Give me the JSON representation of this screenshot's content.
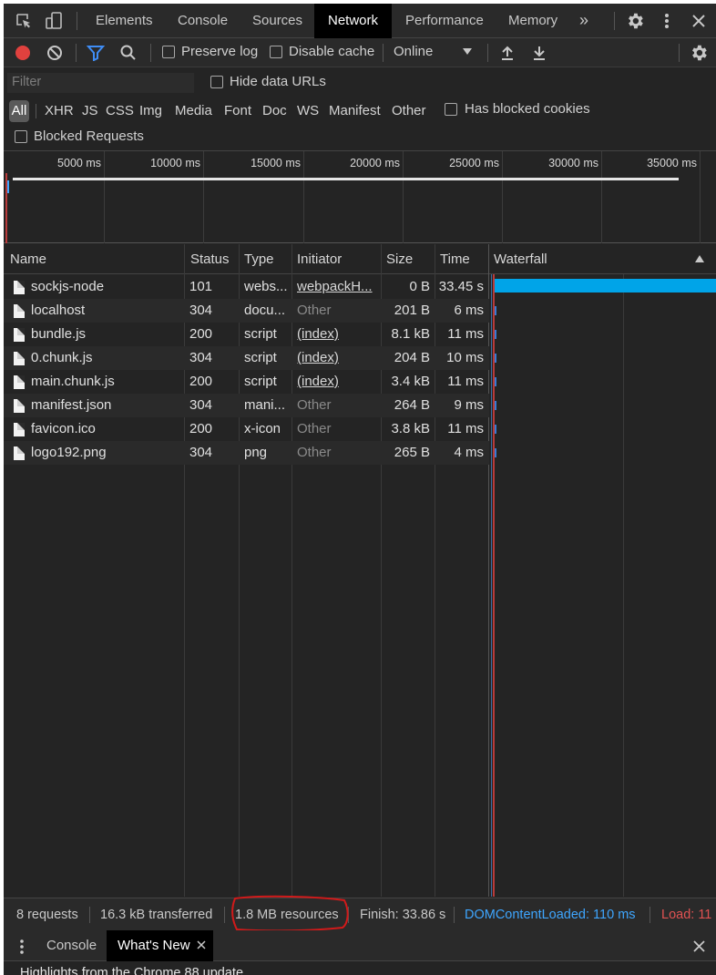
{
  "tabs": [
    {
      "label": "Elements",
      "active": false
    },
    {
      "label": "Console",
      "active": false
    },
    {
      "label": "Sources",
      "active": false
    },
    {
      "label": "Network",
      "active": true
    },
    {
      "label": "Performance",
      "active": false
    },
    {
      "label": "Memory",
      "active": false
    }
  ],
  "toolbar": {
    "preserve_log": "Preserve log",
    "disable_cache": "Disable cache",
    "throttle": "Online"
  },
  "filter": {
    "placeholder": "Filter",
    "hide_data_urls": "Hide data URLs",
    "types": [
      "All",
      "XHR",
      "JS",
      "CSS",
      "Img",
      "Media",
      "Font",
      "Doc",
      "WS",
      "Manifest",
      "Other"
    ],
    "has_blocked_cookies": "Has blocked cookies",
    "blocked_requests": "Blocked Requests"
  },
  "overview": {
    "ticks": [
      "5000 ms",
      "10000 ms",
      "15000 ms",
      "20000 ms",
      "25000 ms",
      "30000 ms",
      "35000 ms"
    ]
  },
  "table": {
    "headers": {
      "name": "Name",
      "status": "Status",
      "type": "Type",
      "initiator": "Initiator",
      "size": "Size",
      "time": "Time",
      "waterfall": "Waterfall"
    },
    "rows": [
      {
        "name": "sockjs-node",
        "status": "101",
        "type": "webs...",
        "initiator": "webpackH...",
        "initiator_link": true,
        "size": "0 B",
        "time": "33.45 s"
      },
      {
        "name": "localhost",
        "status": "304",
        "type": "docu...",
        "initiator": "Other",
        "initiator_link": false,
        "size": "201 B",
        "time": "6 ms"
      },
      {
        "name": "bundle.js",
        "status": "200",
        "type": "script",
        "initiator": "(index)",
        "initiator_link": true,
        "size": "8.1 kB",
        "time": "11 ms"
      },
      {
        "name": "0.chunk.js",
        "status": "304",
        "type": "script",
        "initiator": "(index)",
        "initiator_link": true,
        "size": "204 B",
        "time": "10 ms"
      },
      {
        "name": "main.chunk.js",
        "status": "200",
        "type": "script",
        "initiator": "(index)",
        "initiator_link": true,
        "size": "3.4 kB",
        "time": "11 ms"
      },
      {
        "name": "manifest.json",
        "status": "304",
        "type": "mani...",
        "initiator": "Other",
        "initiator_link": false,
        "size": "264 B",
        "time": "9 ms"
      },
      {
        "name": "favicon.ico",
        "status": "200",
        "type": "x-icon",
        "initiator": "Other",
        "initiator_link": false,
        "size": "3.8 kB",
        "time": "11 ms"
      },
      {
        "name": "logo192.png",
        "status": "304",
        "type": "png",
        "initiator": "Other",
        "initiator_link": false,
        "size": "265 B",
        "time": "4 ms"
      }
    ]
  },
  "status": {
    "requests": "8 requests",
    "transferred": "16.3 kB transferred",
    "resources": "1.8 MB resources",
    "finish": "Finish: 33.86 s",
    "dom_content_loaded": "DOMContentLoaded: 110 ms",
    "load": "Load: 11"
  },
  "drawer": {
    "tabs": [
      "Console",
      "What's New"
    ],
    "whats_new_text": "Highlights from the Chrome 88 update"
  },
  "colors": {
    "dcl": "#3ea6ff",
    "load": "#e05252",
    "waterfall_bar": "#00a4e8",
    "record": "#e0413e",
    "filter_icon": "#3f8df5",
    "annotation": "#d11a1a"
  }
}
